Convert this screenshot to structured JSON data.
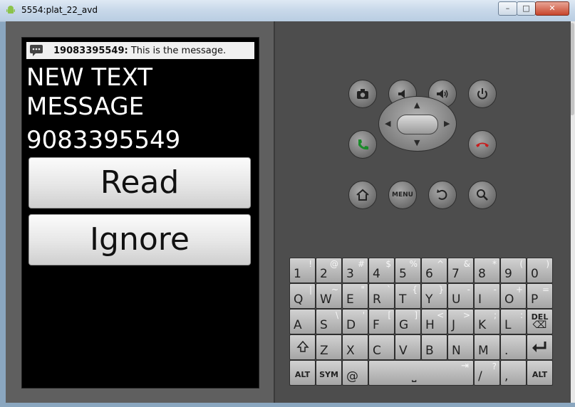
{
  "window": {
    "title": "5554:plat_22_avd",
    "minimize": "–",
    "maximize": "□",
    "close": "✕"
  },
  "screen": {
    "notification": {
      "sender": "19083395549:",
      "text": "This is the message."
    },
    "heading_line1": "NEW TEXT",
    "heading_line2": "MESSAGE",
    "phone_number": "9083395549",
    "read_button": "Read",
    "ignore_button": "Ignore"
  },
  "controls": {
    "menu_label": "MENU",
    "icons": [
      "camera-icon",
      "volume-down-icon",
      "volume-up-icon",
      "power-icon",
      "call-icon",
      "end-call-icon",
      "home-icon",
      "menu-icon",
      "back-icon",
      "search-icon"
    ]
  },
  "keyboard": {
    "row1": [
      {
        "m": "1",
        "s": "!"
      },
      {
        "m": "2",
        "s": "@"
      },
      {
        "m": "3",
        "s": "#"
      },
      {
        "m": "4",
        "s": "$"
      },
      {
        "m": "5",
        "s": "%"
      },
      {
        "m": "6",
        "s": "^"
      },
      {
        "m": "7",
        "s": "&"
      },
      {
        "m": "8",
        "s": "*"
      },
      {
        "m": "9",
        "s": "("
      },
      {
        "m": "0",
        "s": ")"
      }
    ],
    "row2": [
      {
        "m": "Q",
        "s": "|"
      },
      {
        "m": "W",
        "s": "~"
      },
      {
        "m": "E",
        "s": "\""
      },
      {
        "m": "R",
        "s": "`"
      },
      {
        "m": "T",
        "s": "{"
      },
      {
        "m": "Y",
        "s": "}"
      },
      {
        "m": "U",
        "s": "-"
      },
      {
        "m": "I",
        "s": "-"
      },
      {
        "m": "O",
        "s": "+"
      },
      {
        "m": "P",
        "s": "="
      }
    ],
    "row3": [
      {
        "m": "A",
        "s": ""
      },
      {
        "m": "S",
        "s": "\\"
      },
      {
        "m": "D",
        "s": "'"
      },
      {
        "m": "F",
        "s": "["
      },
      {
        "m": "G",
        "s": "]"
      },
      {
        "m": "H",
        "s": "<"
      },
      {
        "m": "J",
        "s": ">"
      },
      {
        "m": "K",
        "s": ";"
      },
      {
        "m": "L",
        "s": ":"
      }
    ],
    "del_label": "DEL",
    "row4": [
      {
        "m": "Z",
        "s": ""
      },
      {
        "m": "X",
        "s": ""
      },
      {
        "m": "C",
        "s": ""
      },
      {
        "m": "V",
        "s": ""
      },
      {
        "m": "B",
        "s": ""
      },
      {
        "m": "N",
        "s": ""
      },
      {
        "m": "M",
        "s": ""
      },
      {
        "m": ".",
        "s": ""
      }
    ],
    "alt_label": "ALT",
    "sym_label": "SYM",
    "at_label": "@",
    "slash_key": {
      "m": "/",
      "s": "?"
    },
    "comma_key": {
      "m": ",",
      "s": ""
    }
  }
}
